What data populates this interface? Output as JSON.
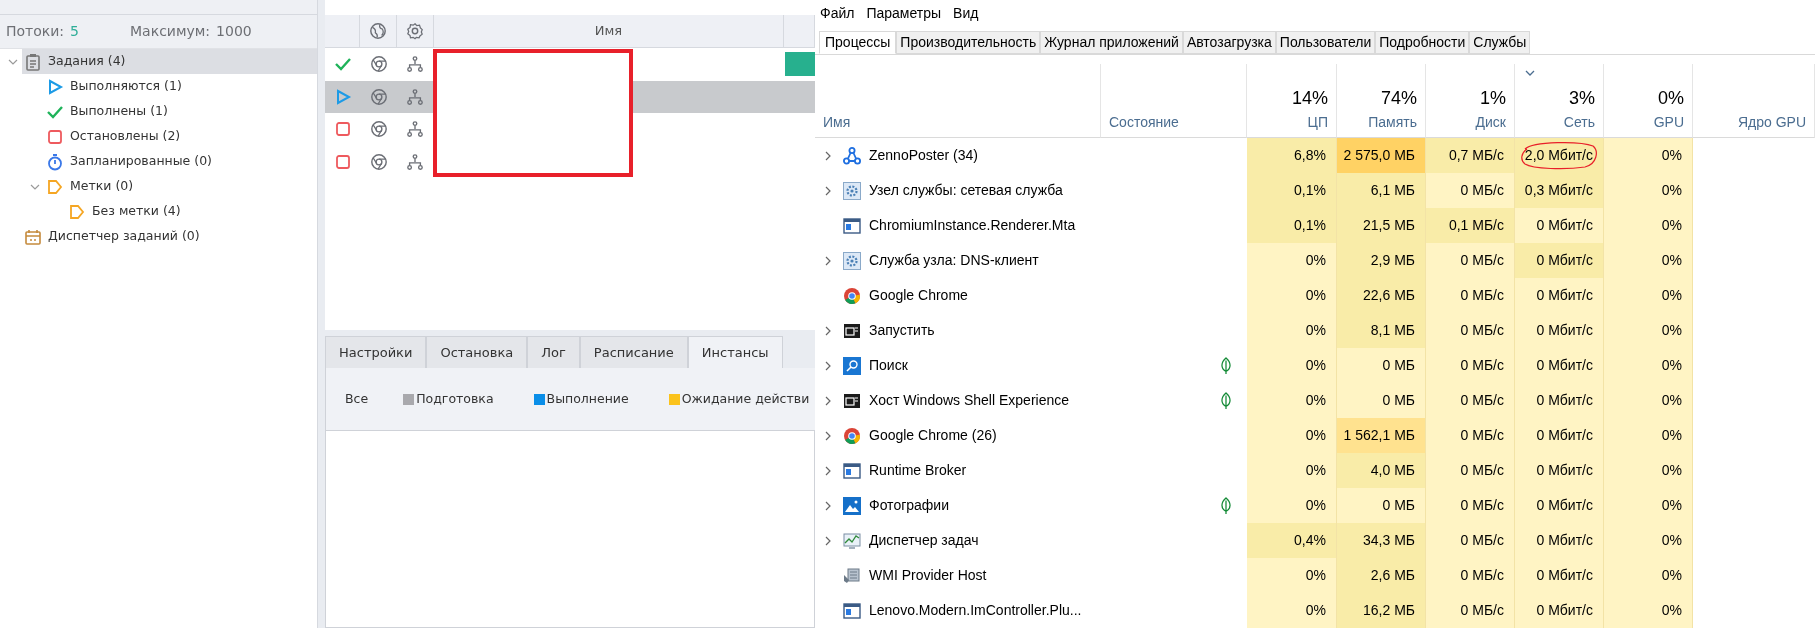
{
  "left_panel": {
    "threads": {
      "label": "Потоки:",
      "value": "5",
      "max_label": "Максимум:",
      "max_value": "1000"
    },
    "tree": [
      {
        "label": "Задания (4)",
        "kind": "clipboard",
        "expanded": true,
        "selected": true,
        "children": [
          {
            "label": "Выполняются (1)",
            "kind": "play",
            "selected": false
          },
          {
            "label": "Выполнены (1)",
            "kind": "check",
            "selected": false
          },
          {
            "label": "Остановлены (2)",
            "kind": "stop",
            "selected": false
          },
          {
            "label": "Запланированные (0)",
            "kind": "timer",
            "selected": false
          },
          {
            "label": "Метки (0)",
            "kind": "tag",
            "expanded": true,
            "selected": false,
            "children": [
              {
                "label": "Без метки (4)",
                "kind": "tag",
                "selected": false
              }
            ]
          }
        ]
      },
      {
        "label": "Диспетчер заданий (0)",
        "kind": "calendar",
        "selected": false
      }
    ]
  },
  "task_table": {
    "columns": [
      "Имя"
    ],
    "rows": [
      {
        "kind": "done",
        "selected": false,
        "progress_bar": true
      },
      {
        "kind": "running",
        "selected": true,
        "progress_bar": false
      },
      {
        "kind": "stopped",
        "selected": false,
        "progress_bar": false
      },
      {
        "kind": "stopped",
        "selected": false,
        "progress_bar": false
      }
    ]
  },
  "bottom_tabs": [
    {
      "label": "Настройки",
      "selected": false
    },
    {
      "label": "Остановка",
      "selected": false
    },
    {
      "label": "Лог",
      "selected": false
    },
    {
      "label": "Расписание",
      "selected": false
    },
    {
      "label": "Инстансы",
      "selected": true
    }
  ],
  "legend": [
    {
      "label": "Все"
    },
    {
      "label": "Подготовка",
      "color": "#a9a9ad"
    },
    {
      "label": "Выполнение",
      "color": "#0a8ee8"
    },
    {
      "label": "Ожидание действи",
      "color": "#fbc31c"
    }
  ],
  "task_manager": {
    "menu": [
      "Файл",
      "Параметры",
      "Вид"
    ],
    "tabs": [
      {
        "label": "Процессы",
        "selected": true
      },
      {
        "label": "Производительность",
        "selected": false
      },
      {
        "label": "Журнал приложений",
        "selected": false
      },
      {
        "label": "Автозагрузка",
        "selected": false
      },
      {
        "label": "Пользователи",
        "selected": false
      },
      {
        "label": "Подробности",
        "selected": false
      },
      {
        "label": "Службы",
        "selected": false
      }
    ],
    "columns": [
      {
        "label": "Имя",
        "sorted": false
      },
      {
        "label": "Состояние",
        "sorted": false
      },
      {
        "label": "ЦП",
        "percent": "14%",
        "sorted": false
      },
      {
        "label": "Память",
        "percent": "74%",
        "sorted": false
      },
      {
        "label": "Диск",
        "percent": "1%",
        "sorted": false
      },
      {
        "label": "Сеть",
        "percent": "3%",
        "sorted": true
      },
      {
        "label": "GPU",
        "percent": "0%",
        "sorted": false
      },
      {
        "label": "Ядро GPU",
        "sorted": false
      }
    ],
    "processes": [
      {
        "name": "ZennoPoster (34)",
        "kind": "network",
        "expandable": true,
        "eco": false,
        "cells": [
          {
            "text": "6,8%",
            "color": "#f9eca8",
            "circled": false
          },
          {
            "text": "2 575,0 МБ",
            "color": "#ffd264",
            "circled": false
          },
          {
            "text": "0,7 МБ/с",
            "color": "#f9eca8",
            "circled": false
          },
          {
            "text": "2,0 Мбит/с",
            "color": "#f9eca8",
            "circled": true
          },
          {
            "text": "0%",
            "color": "#fff4c4",
            "circled": false
          }
        ]
      },
      {
        "name": "Узел службы: сетевая служба",
        "kind": "gear",
        "expandable": true,
        "eco": false,
        "cells": [
          {
            "text": "0,1%",
            "color": "#f9eca8",
            "circled": false
          },
          {
            "text": "6,1 МБ",
            "color": "#f9eca8",
            "circled": false
          },
          {
            "text": "0 МБ/с",
            "color": "#fff4c4",
            "circled": false
          },
          {
            "text": "0,3 Мбит/с",
            "color": "#f9eca8",
            "circled": false
          },
          {
            "text": "0%",
            "color": "#fff4c4",
            "circled": false
          }
        ]
      },
      {
        "name": "ChromiumInstance.Renderer.Mta",
        "kind": "window",
        "expandable": false,
        "eco": false,
        "cells": [
          {
            "text": "0,1%",
            "color": "#f9eca8",
            "circled": false
          },
          {
            "text": "21,5 МБ",
            "color": "#f9eca8",
            "circled": false
          },
          {
            "text": "0,1 МБ/с",
            "color": "#f9eca8",
            "circled": false
          },
          {
            "text": "0 Мбит/с",
            "color": "#fff4c4",
            "circled": false
          },
          {
            "text": "0%",
            "color": "#fff4c4",
            "circled": false
          }
        ]
      },
      {
        "name": "Служба узла: DNS-клиент",
        "kind": "gear",
        "expandable": true,
        "eco": false,
        "cells": [
          {
            "text": "0%",
            "color": "#fff4c4",
            "circled": false
          },
          {
            "text": "2,9 МБ",
            "color": "#f9eca8",
            "circled": false
          },
          {
            "text": "0 МБ/с",
            "color": "#fff4c4",
            "circled": false
          },
          {
            "text": "0 Мбит/с",
            "color": "#f9eca8",
            "circled": false
          },
          {
            "text": "0%",
            "color": "#fff4c4",
            "circled": false
          }
        ]
      },
      {
        "name": "Google Chrome",
        "kind": "chrome",
        "expandable": false,
        "eco": false,
        "cells": [
          {
            "text": "0%",
            "color": "#fff4c4",
            "circled": false
          },
          {
            "text": "22,6 МБ",
            "color": "#f9eca8",
            "circled": false
          },
          {
            "text": "0 МБ/с",
            "color": "#fff4c4",
            "circled": false
          },
          {
            "text": "0 Мбит/с",
            "color": "#fff4c4",
            "circled": false
          },
          {
            "text": "0%",
            "color": "#fff4c4",
            "circled": false
          }
        ]
      },
      {
        "name": "Запустить",
        "kind": "terminal",
        "expandable": true,
        "eco": false,
        "cells": [
          {
            "text": "0%",
            "color": "#fff4c4",
            "circled": false
          },
          {
            "text": "8,1 МБ",
            "color": "#f9eca8",
            "circled": false
          },
          {
            "text": "0 МБ/с",
            "color": "#fff4c4",
            "circled": false
          },
          {
            "text": "0 Мбит/с",
            "color": "#fff4c4",
            "circled": false
          },
          {
            "text": "0%",
            "color": "#fff4c4",
            "circled": false
          }
        ]
      },
      {
        "name": "Поиск",
        "kind": "search",
        "expandable": true,
        "eco": true,
        "cells": [
          {
            "text": "0%",
            "color": "#fff4c4",
            "circled": false
          },
          {
            "text": "0 МБ",
            "color": "#fff4c4",
            "circled": false
          },
          {
            "text": "0 МБ/с",
            "color": "#fff4c4",
            "circled": false
          },
          {
            "text": "0 Мбит/с",
            "color": "#fff4c4",
            "circled": false
          },
          {
            "text": "0%",
            "color": "#fff4c4",
            "circled": false
          }
        ]
      },
      {
        "name": "Хост Windows Shell Experience",
        "kind": "terminal",
        "expandable": true,
        "eco": true,
        "cells": [
          {
            "text": "0%",
            "color": "#fff4c4",
            "circled": false
          },
          {
            "text": "0 МБ",
            "color": "#fff4c4",
            "circled": false
          },
          {
            "text": "0 МБ/с",
            "color": "#fff4c4",
            "circled": false
          },
          {
            "text": "0 Мбит/с",
            "color": "#fff4c4",
            "circled": false
          },
          {
            "text": "0%",
            "color": "#fff4c4",
            "circled": false
          }
        ]
      },
      {
        "name": "Google Chrome (26)",
        "kind": "chrome",
        "expandable": true,
        "eco": false,
        "cells": [
          {
            "text": "0%",
            "color": "#fff4c4",
            "circled": false
          },
          {
            "text": "1 562,1 МБ",
            "color": "#ffe28f",
            "circled": false
          },
          {
            "text": "0 МБ/с",
            "color": "#fff4c4",
            "circled": false
          },
          {
            "text": "0 Мбит/с",
            "color": "#fff4c4",
            "circled": false
          },
          {
            "text": "0%",
            "color": "#fff4c4",
            "circled": false
          }
        ]
      },
      {
        "name": "Runtime Broker",
        "kind": "window",
        "expandable": true,
        "eco": false,
        "cells": [
          {
            "text": "0%",
            "color": "#fff4c4",
            "circled": false
          },
          {
            "text": "4,0 МБ",
            "color": "#f9eca8",
            "circled": false
          },
          {
            "text": "0 МБ/с",
            "color": "#fff4c4",
            "circled": false
          },
          {
            "text": "0 Мбит/с",
            "color": "#fff4c4",
            "circled": false
          },
          {
            "text": "0%",
            "color": "#fff4c4",
            "circled": false
          }
        ]
      },
      {
        "name": "Фотографии",
        "kind": "photos",
        "expandable": true,
        "eco": true,
        "cells": [
          {
            "text": "0%",
            "color": "#fff4c4",
            "circled": false
          },
          {
            "text": "0 МБ",
            "color": "#fff4c4",
            "circled": false
          },
          {
            "text": "0 МБ/с",
            "color": "#fff4c4",
            "circled": false
          },
          {
            "text": "0 Мбит/с",
            "color": "#fff4c4",
            "circled": false
          },
          {
            "text": "0%",
            "color": "#fff4c4",
            "circled": false
          }
        ]
      },
      {
        "name": "Диспетчер задач",
        "kind": "chart",
        "expandable": true,
        "eco": false,
        "cells": [
          {
            "text": "0,4%",
            "color": "#f9eca8",
            "circled": false
          },
          {
            "text": "34,3 МБ",
            "color": "#f9eca8",
            "circled": false
          },
          {
            "text": "0 МБ/с",
            "color": "#fff4c4",
            "circled": false
          },
          {
            "text": "0 Мбит/с",
            "color": "#fff4c4",
            "circled": false
          },
          {
            "text": "0%",
            "color": "#fff4c4",
            "circled": false
          }
        ]
      },
      {
        "name": "WMI Provider Host",
        "kind": "wmi",
        "expandable": false,
        "eco": false,
        "cells": [
          {
            "text": "0%",
            "color": "#fff4c4",
            "circled": false
          },
          {
            "text": "2,6 МБ",
            "color": "#f9eca8",
            "circled": false
          },
          {
            "text": "0 МБ/с",
            "color": "#fff4c4",
            "circled": false
          },
          {
            "text": "0 Мбит/с",
            "color": "#fff4c4",
            "circled": false
          },
          {
            "text": "0%",
            "color": "#fff4c4",
            "circled": false
          }
        ]
      },
      {
        "name": "Lenovo.Modern.ImController.Plu...",
        "kind": "window",
        "expandable": false,
        "eco": false,
        "cells": [
          {
            "text": "0%",
            "color": "#fff4c4",
            "circled": false
          },
          {
            "text": "16,2 МБ",
            "color": "#f9eca8",
            "circled": false
          },
          {
            "text": "0 МБ/с",
            "color": "#fff4c4",
            "circled": false
          },
          {
            "text": "0 Мбит/с",
            "color": "#fff4c4",
            "circled": false
          },
          {
            "text": "0%",
            "color": "#fff4c4",
            "circled": false
          }
        ]
      }
    ]
  }
}
